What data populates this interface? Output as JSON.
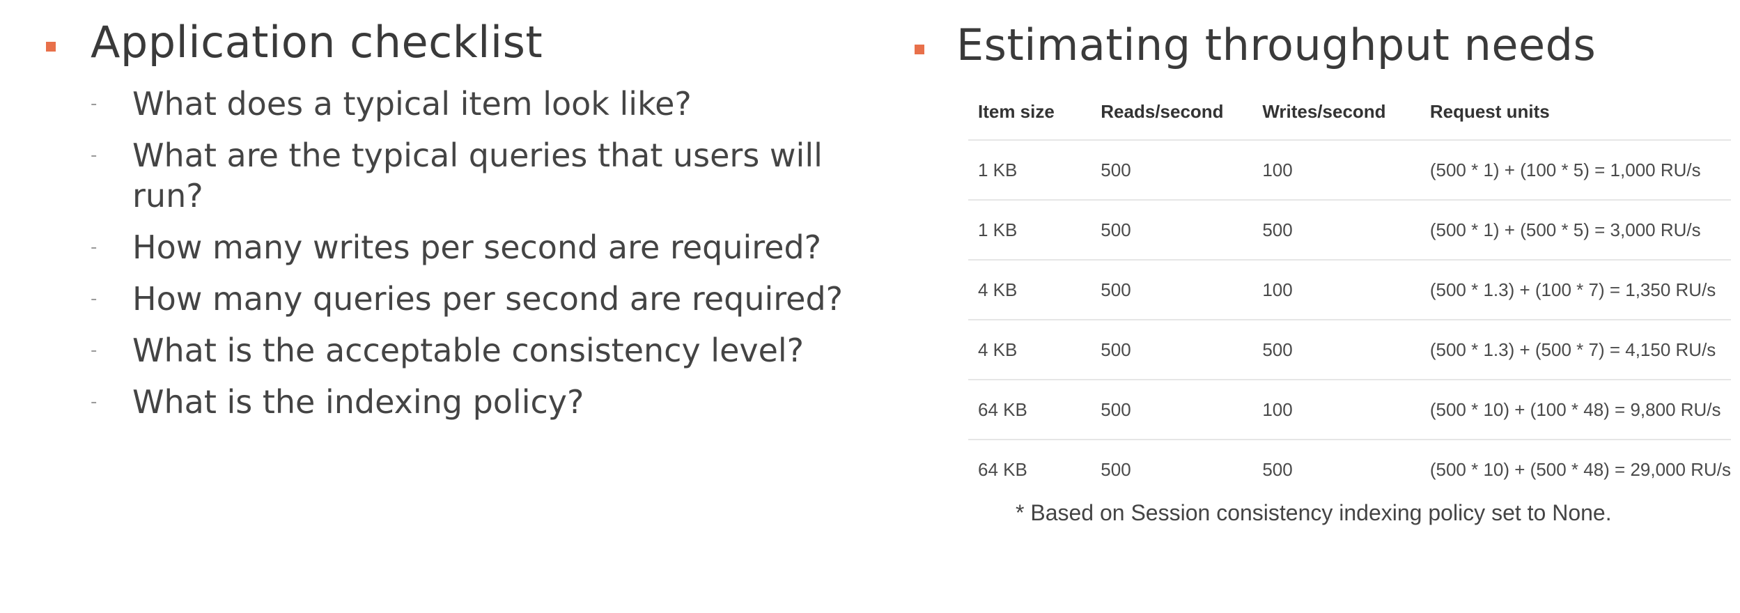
{
  "left": {
    "title": "Application checklist",
    "items": [
      "What does a typical item look like?",
      "What are the typical queries that users will run?",
      "How many writes per second are required?",
      "How many queries per second are required?",
      "What is the acceptable consistency level?",
      "What is the indexing policy?"
    ]
  },
  "right": {
    "title": "Estimating throughput needs",
    "table": {
      "headers": [
        "Item size",
        "Reads/second",
        "Writes/second",
        "Request units"
      ],
      "rows": [
        [
          "1 KB",
          "500",
          "100",
          "(500 * 1) + (100 * 5) = 1,000 RU/s"
        ],
        [
          "1 KB",
          "500",
          "500",
          "(500 * 1) + (500 * 5) = 3,000 RU/s"
        ],
        [
          "4 KB",
          "500",
          "100",
          "(500 * 1.3) + (100 * 7) = 1,350 RU/s"
        ],
        [
          "4 KB",
          "500",
          "500",
          "(500 * 1.3) + (500 * 7) = 4,150 RU/s"
        ],
        [
          "64 KB",
          "500",
          "100",
          "(500 * 10) + (100 * 48) = 9,800 RU/s"
        ],
        [
          "64 KB",
          "500",
          "500",
          "(500 * 10) + (500 * 48) = 29,000 RU/s"
        ]
      ]
    },
    "footnote": "* Based on Session consistency indexing policy set to None."
  },
  "colors": {
    "bullet": "#e8704a",
    "text": "#3d3d3d",
    "rule": "#e6e6e6"
  }
}
